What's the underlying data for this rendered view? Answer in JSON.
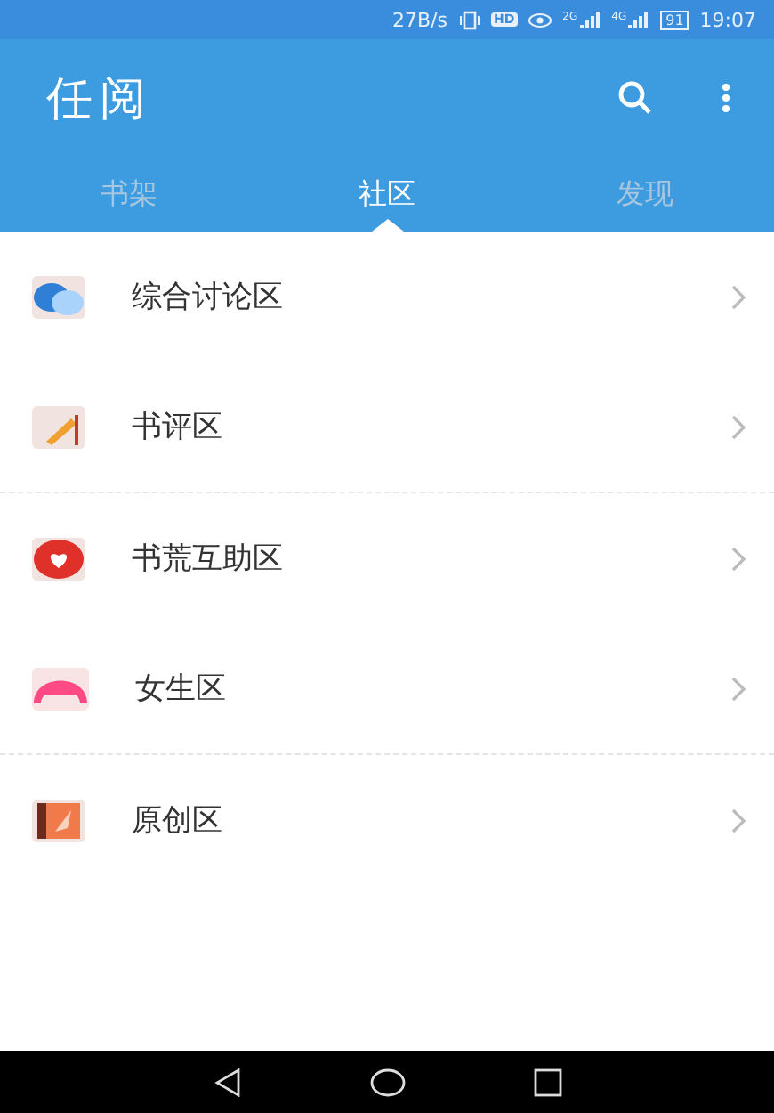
{
  "status_bar": {
    "speed": "27B/s",
    "hd": "HD",
    "signals": [
      "2G",
      "4G"
    ],
    "battery": "91",
    "time": "19:07"
  },
  "app_bar": {
    "title": "任阅"
  },
  "tabs": [
    {
      "label": "书架",
      "selected": false
    },
    {
      "label": "社区",
      "selected": true
    },
    {
      "label": "发现",
      "selected": false
    }
  ],
  "sections": [
    [
      {
        "label": "综合讨论区",
        "kind": "chat"
      },
      {
        "label": "书评区",
        "kind": "pencil"
      }
    ],
    [
      {
        "label": "书荒互助区",
        "kind": "heart"
      },
      {
        "label": "女生区",
        "kind": "girl"
      }
    ],
    [
      {
        "label": "原创区",
        "kind": "book"
      }
    ]
  ]
}
